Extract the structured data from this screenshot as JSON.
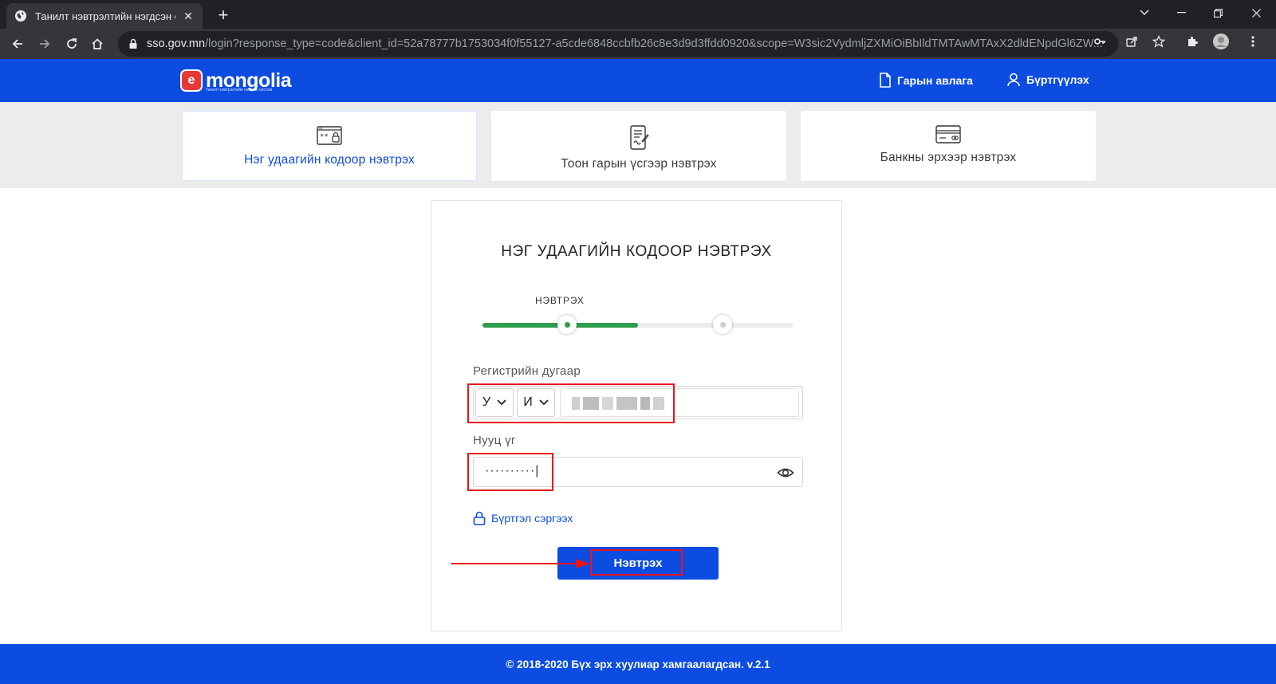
{
  "browser": {
    "tab_title": "Танилт нэвтрэлтийн нэгдсэн сис",
    "url_host": "sso.gov.mn",
    "url_path": "/login?response_type=code&client_id=52a78777b1753034f0f55127-a5cde6848ccbfb26c8e3d9d3ffdd0920&scope=W3sic2VydmljZXMiOiBbIldTMTAwMTAxX2dldENpdGl6ZW..."
  },
  "header": {
    "logo_text": "mongolia",
    "logo_mark": "e",
    "logo_subtitle": "Танилт нэвтрэлтийн нэгдсэн систем",
    "guide_link": "Гарын авлага",
    "register_link": "Бүртгүүлэх"
  },
  "methods": [
    {
      "label": "Нэг удаагийн кодоор нэвтрэх",
      "icon": "password-screen-icon",
      "active": true
    },
    {
      "label": "Тоон гарын үсгээр нэвтрэх",
      "icon": "digital-signature-icon",
      "active": false
    },
    {
      "label": "Банкны эрхээр нэвтрэх",
      "icon": "bank-card-icon",
      "active": false
    }
  ],
  "form": {
    "title": "НЭГ УДААГИЙН КОДООР НЭВТРЭХ",
    "step_label": "НЭВТРЭХ",
    "progress_fraction": 0.5,
    "reg_label": "Регистрийн дугаар",
    "reg_letter_1": "У",
    "reg_letter_2": "И",
    "password_label": "Нууц үг",
    "password_value": "··········|",
    "restore_link": "Бүртгэл сэргээх",
    "login_button": "Нэвтрэх"
  },
  "colors": {
    "brand_blue": "#0c4ce0",
    "progress_green": "#2e9d4c",
    "annotation_red": "#e8141b"
  },
  "footer": {
    "copyright": "© 2018-2020 Бүх эрх хуулиар хамгаалагдсан. v.2.1"
  }
}
